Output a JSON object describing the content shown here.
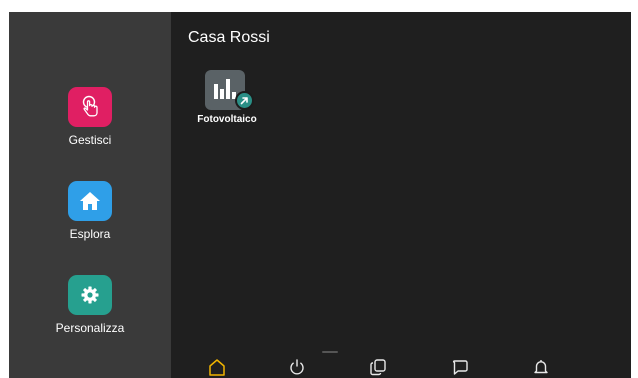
{
  "sidebar": {
    "items": [
      {
        "label": "Gestisci",
        "icon": "hand-tap-icon",
        "color": "#e01f63"
      },
      {
        "label": "Esplora",
        "icon": "home-icon",
        "color": "#2f9fe8"
      },
      {
        "label": "Personalizza",
        "icon": "gear-icon",
        "color": "#26a08f"
      }
    ]
  },
  "main": {
    "title": "Casa Rossi",
    "apps": [
      {
        "label": "Fotovoltaico",
        "icon": "bar-chart-icon",
        "badge": "shortcut-arrow-icon"
      }
    ]
  },
  "bottom_nav": {
    "items": [
      "home-icon",
      "power-icon",
      "copy-icon",
      "chat-icon",
      "bell-icon"
    ],
    "active": "home-icon",
    "active_color": "#f0b400",
    "inactive_color": "#e8e8e8"
  }
}
